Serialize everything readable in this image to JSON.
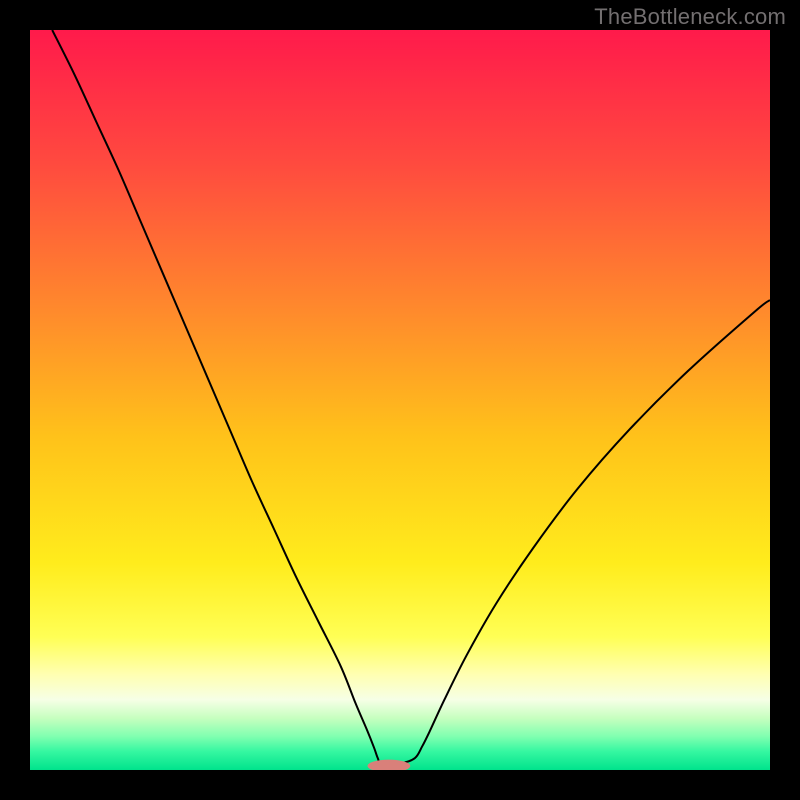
{
  "watermark": "TheBottleneck.com",
  "chart_data": {
    "type": "line",
    "title": "",
    "xlabel": "",
    "ylabel": "",
    "xlim": [
      0,
      100
    ],
    "ylim": [
      0,
      100
    ],
    "grid": false,
    "legend": false,
    "background_gradient": {
      "stops": [
        {
          "pos": 0.0,
          "color": "#ff1a4b"
        },
        {
          "pos": 0.18,
          "color": "#ff4a3f"
        },
        {
          "pos": 0.38,
          "color": "#ff8a2c"
        },
        {
          "pos": 0.55,
          "color": "#ffc21a"
        },
        {
          "pos": 0.72,
          "color": "#ffec1c"
        },
        {
          "pos": 0.82,
          "color": "#ffff55"
        },
        {
          "pos": 0.87,
          "color": "#ffffb0"
        },
        {
          "pos": 0.905,
          "color": "#f6ffe6"
        },
        {
          "pos": 0.93,
          "color": "#c6ffbf"
        },
        {
          "pos": 0.955,
          "color": "#7fffb0"
        },
        {
          "pos": 0.975,
          "color": "#35f7a1"
        },
        {
          "pos": 1.0,
          "color": "#00e38c"
        }
      ]
    },
    "series": [
      {
        "name": "bottleneck-curve",
        "color": "#000000",
        "width": 2,
        "x": [
          3,
          6,
          9,
          12,
          15,
          18,
          21,
          24,
          27,
          30,
          33,
          36,
          39,
          42,
          44,
          45.5,
          46.5,
          47,
          47.5,
          50,
          52,
          53,
          54,
          56,
          59,
          63,
          68,
          74,
          81,
          89,
          98,
          100
        ],
        "y": [
          100,
          94,
          87.5,
          81,
          74,
          67,
          60,
          53,
          46,
          39,
          32.5,
          26,
          20,
          14,
          9,
          5.5,
          3,
          1.6,
          0.9,
          0.9,
          1.6,
          3.2,
          5.2,
          9.5,
          15.5,
          22.5,
          30,
          38,
          46,
          54,
          62,
          63.5
        ]
      }
    ],
    "marker": {
      "name": "optimum-marker",
      "cx": 48.5,
      "cy": 0.55,
      "rx": 2.9,
      "ry": 0.85,
      "fill": "#d9807a"
    }
  }
}
